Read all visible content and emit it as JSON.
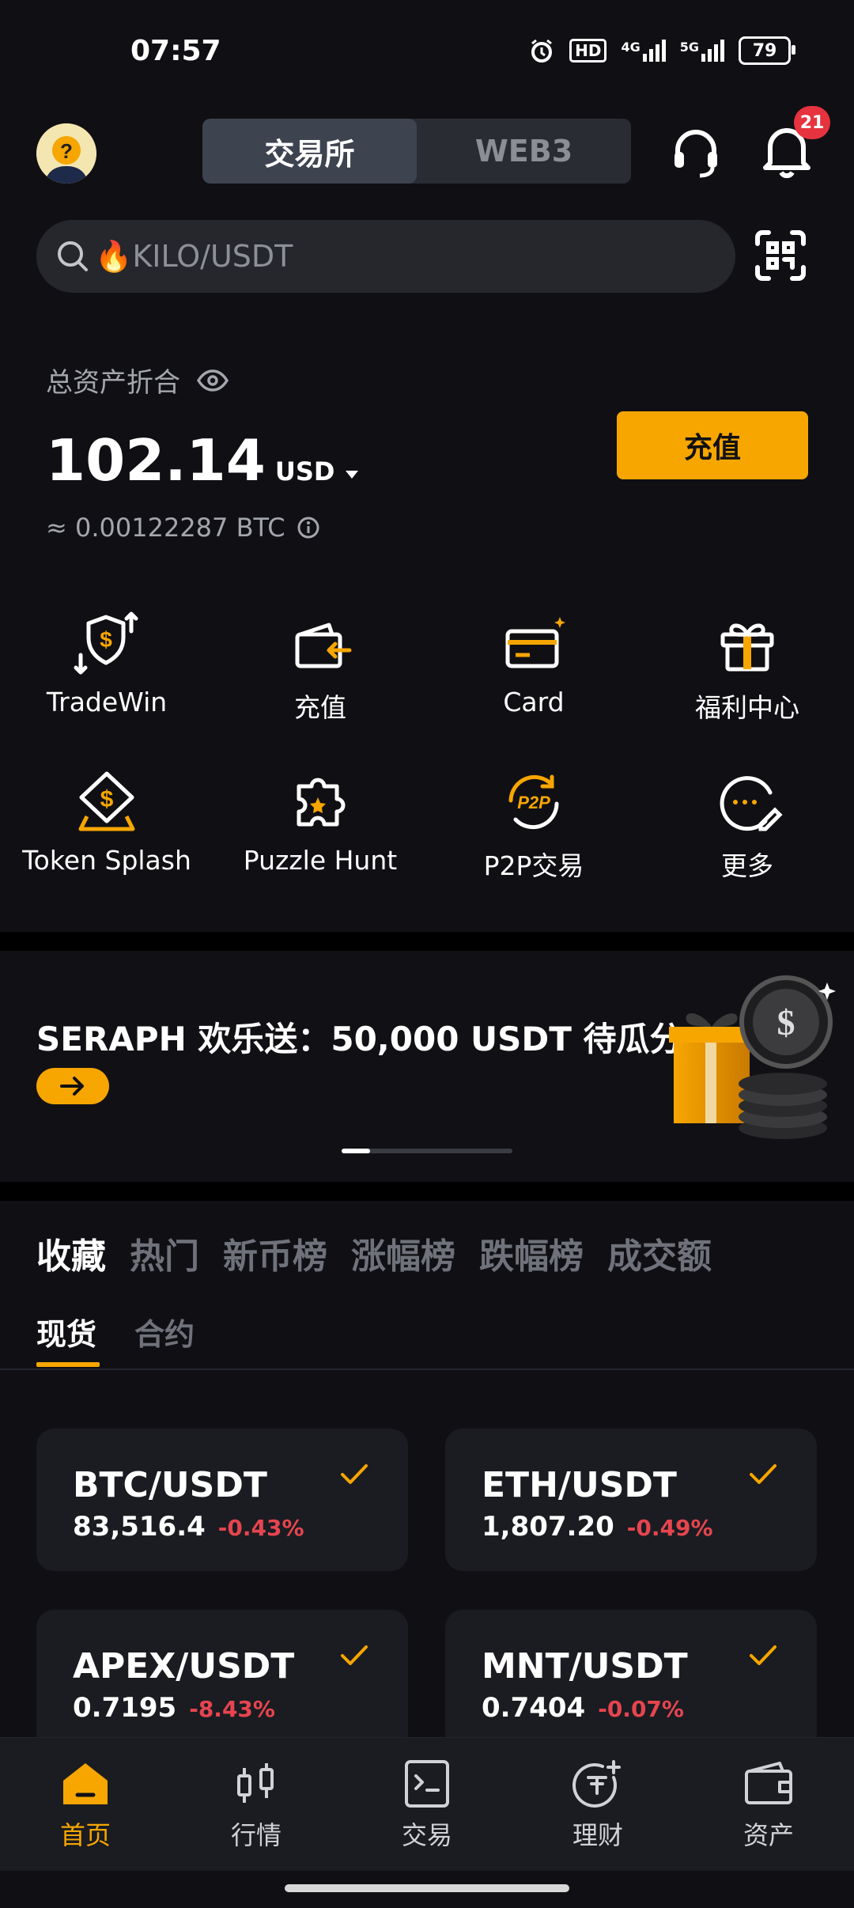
{
  "status_bar": {
    "time": "07:57",
    "network_a": "4G",
    "network_b": "5G",
    "hd": "HD",
    "battery": "79"
  },
  "header": {
    "segments": [
      {
        "label": "交易所",
        "active": true
      },
      {
        "label": "WEB3",
        "active": false
      }
    ],
    "notification_count": "21"
  },
  "search": {
    "text": "🔥KILO/USDT"
  },
  "assets": {
    "label": "总资产折合",
    "balance": "102.14",
    "currency": "USD",
    "btc_equiv": "≈ 0.00122287 BTC",
    "deposit_label": "充值"
  },
  "quick_actions": [
    {
      "label": "TradeWin",
      "icon": "tradewin-icon"
    },
    {
      "label": "充值",
      "icon": "deposit-wallet-icon"
    },
    {
      "label": "Card",
      "icon": "card-icon"
    },
    {
      "label": "福利中心",
      "icon": "gift-icon"
    },
    {
      "label": "Token Splash",
      "icon": "token-splash-icon"
    },
    {
      "label": "Puzzle Hunt",
      "icon": "puzzle-icon"
    },
    {
      "label": "P2P交易",
      "icon": "p2p-icon"
    },
    {
      "label": "更多",
      "icon": "more-icon"
    }
  ],
  "banner": {
    "title": "SERAPH 欢乐送：50,000 USDT 待瓜分"
  },
  "market_tabs": [
    {
      "label": "收藏",
      "active": true
    },
    {
      "label": "热门",
      "active": false
    },
    {
      "label": "新币榜",
      "active": false
    },
    {
      "label": "涨幅榜",
      "active": false
    },
    {
      "label": "跌幅榜",
      "active": false
    },
    {
      "label": "成交额",
      "active": false
    }
  ],
  "sub_tabs": [
    {
      "label": "现货",
      "active": true
    },
    {
      "label": "合约",
      "active": false
    }
  ],
  "watchlist": [
    {
      "pair": "BTC/USDT",
      "price": "83,516.4",
      "change": "-0.43%"
    },
    {
      "pair": "ETH/USDT",
      "price": "1,807.20",
      "change": "-0.49%"
    },
    {
      "pair": "APEX/USDT",
      "price": "0.7195",
      "change": "-8.43%"
    },
    {
      "pair": "MNT/USDT",
      "price": "0.7404",
      "change": "-0.07%"
    }
  ],
  "bottom_nav": [
    {
      "label": "首页",
      "icon": "home-icon",
      "active": true
    },
    {
      "label": "行情",
      "icon": "market-candles-icon",
      "active": false
    },
    {
      "label": "交易",
      "icon": "trade-icon",
      "active": false
    },
    {
      "label": "理财",
      "icon": "earn-icon",
      "active": false
    },
    {
      "label": "资产",
      "icon": "wallet-icon",
      "active": false
    }
  ],
  "colors": {
    "accent": "#f7a600",
    "background": "#101014",
    "negative": "#e6454f"
  }
}
